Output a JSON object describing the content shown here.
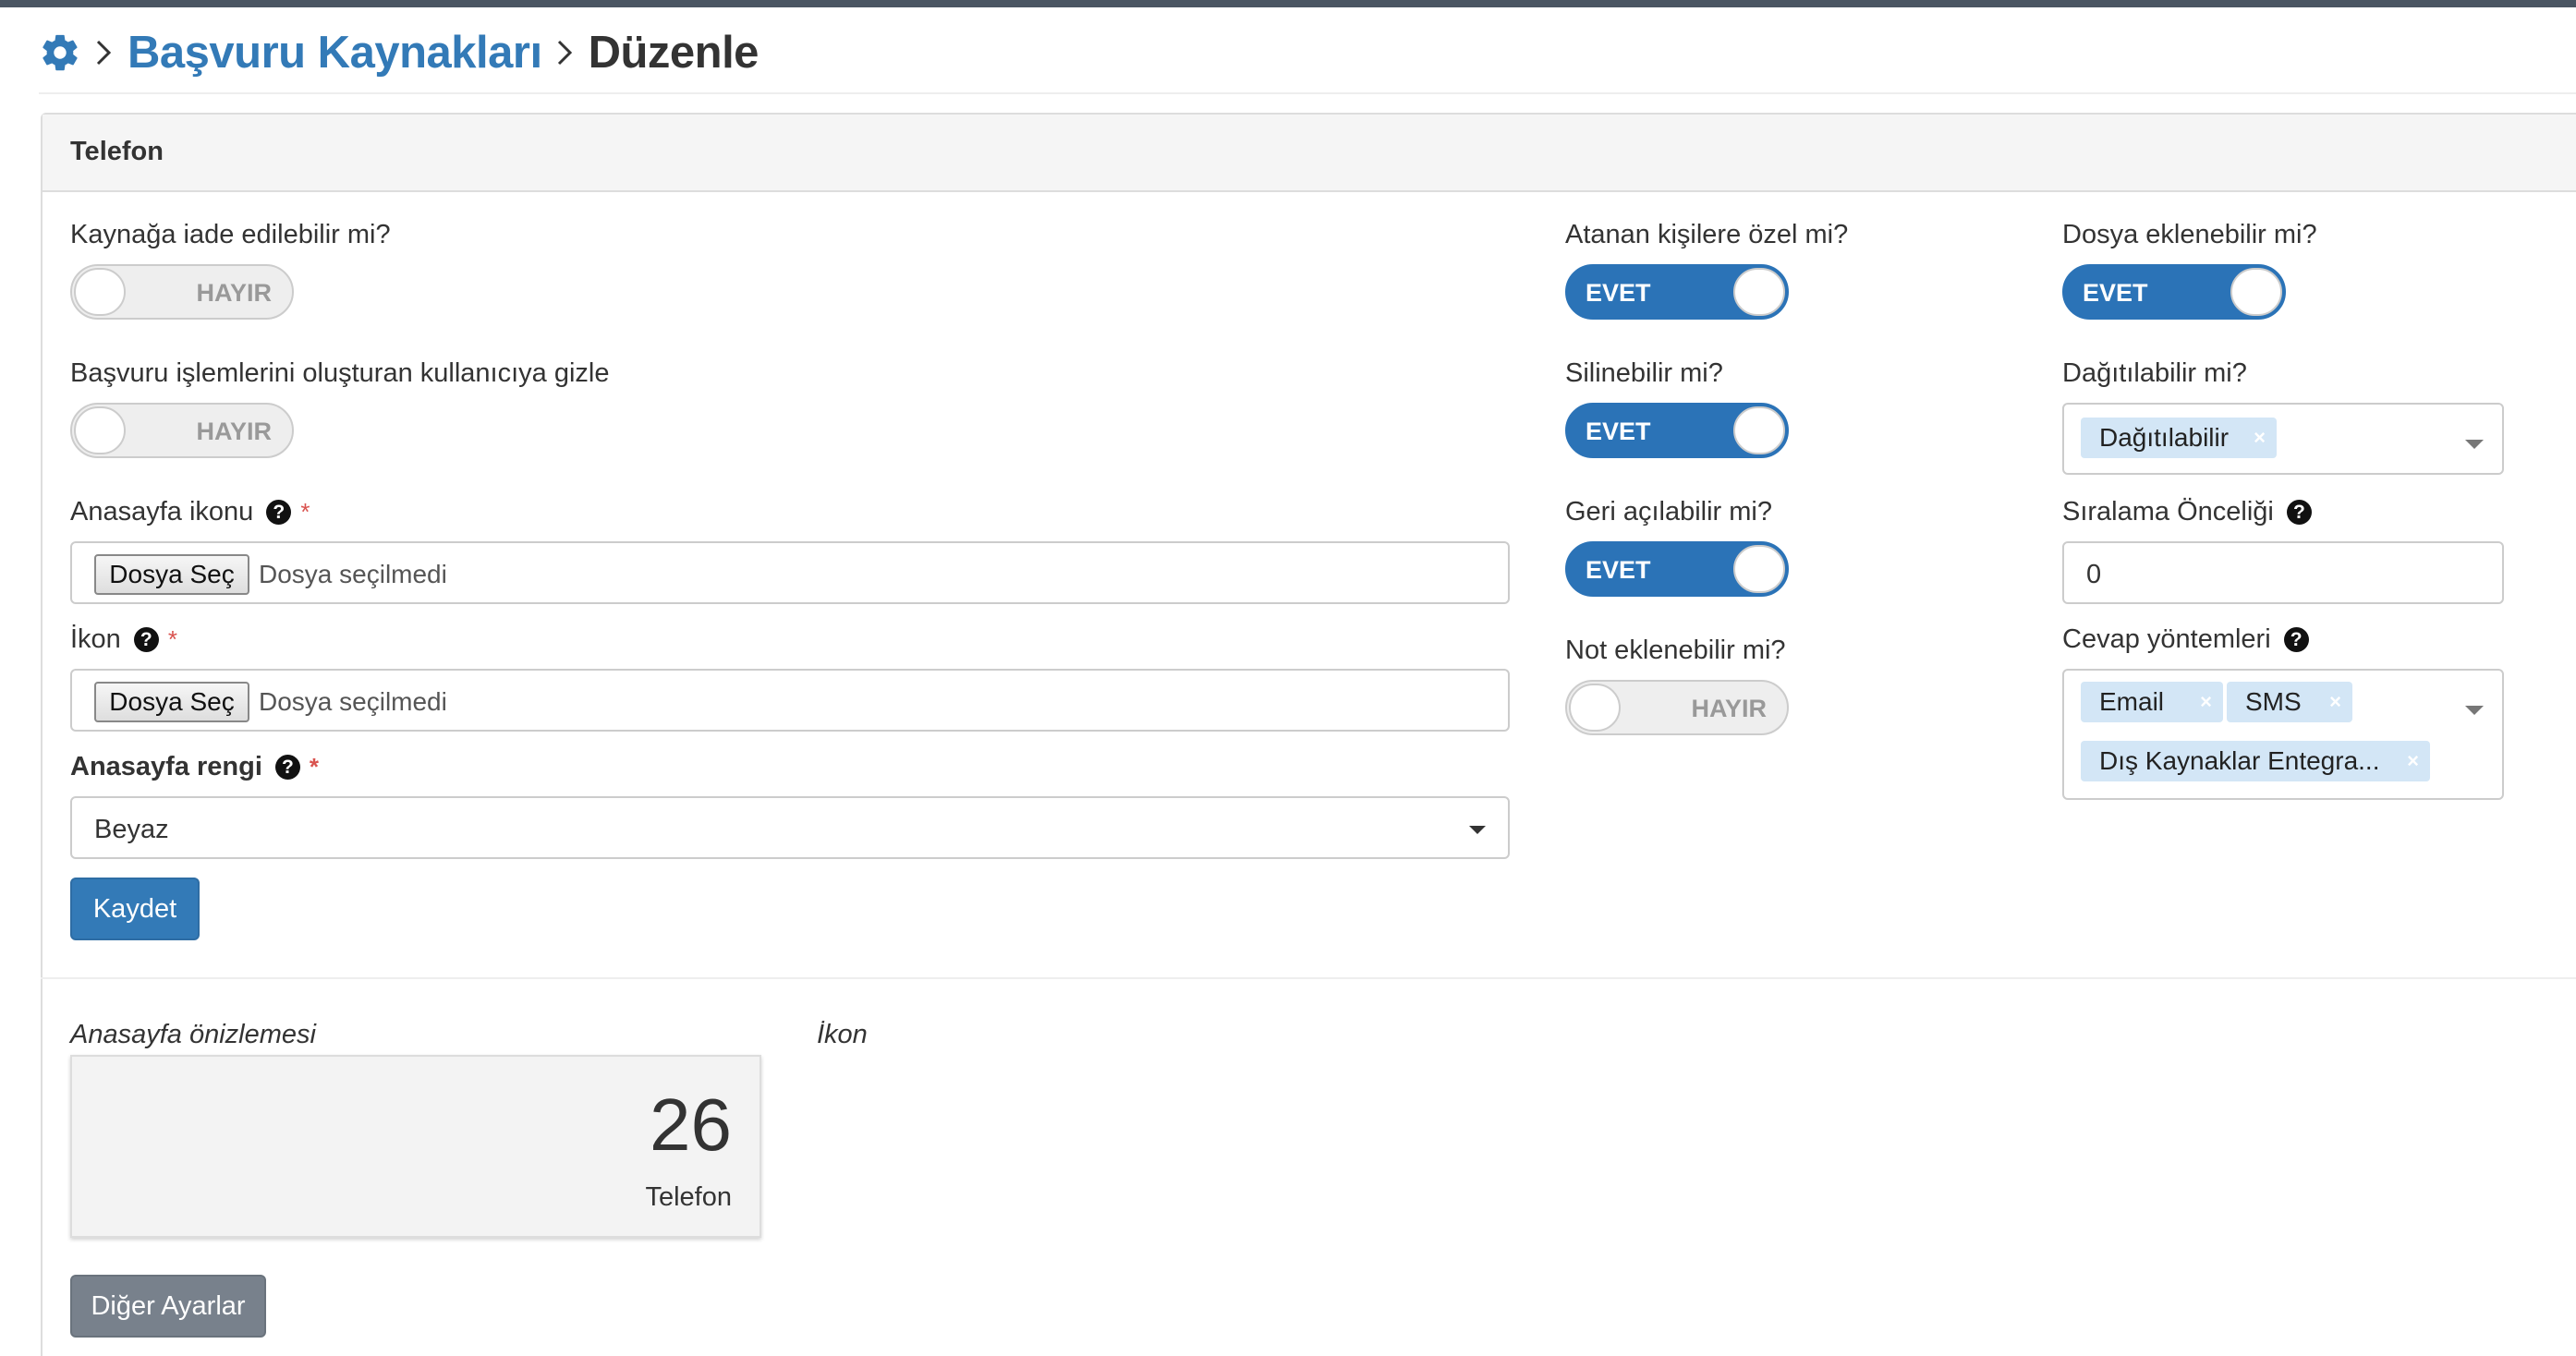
{
  "breadcrumb": {
    "icon": "gear-icon",
    "link": "Başvuru Kaynakları",
    "current": "Düzenle"
  },
  "panel": {
    "title": "Telefon"
  },
  "left": {
    "returnable_label": "Kaynağa iade edilebilir mi?",
    "returnable_state": "HAYIR",
    "hide_label": "Başvuru işlemlerini oluşturan kullanıcıya gizle",
    "hide_state": "HAYIR",
    "home_icon_label": "Anasayfa ikonu",
    "icon_label": "İkon",
    "file_button": "Dosya Seç",
    "file_none": "Dosya seçilmedi",
    "home_color_label": "Anasayfa rengi",
    "home_color_value": "Beyaz",
    "required_mark": "*",
    "help_mark": "?",
    "save_label": "Kaydet"
  },
  "middle": {
    "assigned_label": "Atanan kişilere özel mi?",
    "assigned_state": "EVET",
    "deletable_label": "Silinebilir mi?",
    "deletable_state": "EVET",
    "reopenable_label": "Geri açılabilir mi?",
    "reopenable_state": "EVET",
    "note_label": "Not eklenebilir mi?",
    "note_state": "HAYIR"
  },
  "right": {
    "attach_label": "Dosya eklenebilir mi?",
    "attach_state": "EVET",
    "distributable_label": "Dağıtılabilir mi?",
    "distributable_tags": [
      "Dağıtılabilir"
    ],
    "sort_label": "Sıralama Önceliği",
    "sort_value": "0",
    "reply_label": "Cevap yöntemleri",
    "reply_tags": [
      "Email",
      "SMS",
      "Dış Kaynaklar Entegra..."
    ],
    "tag_remove": "×"
  },
  "preview": {
    "label": "Anasayfa önizlemesi",
    "icon_label": "İkon",
    "count": "26",
    "name": "Telefon",
    "other_settings_label": "Diğer Ayarlar"
  },
  "colors": {
    "primary": "#337ab7",
    "switch_on": "#2b73b7",
    "tag_bg": "#d3e6f6",
    "required": "#d9534f",
    "secondary_button": "#78818c"
  }
}
